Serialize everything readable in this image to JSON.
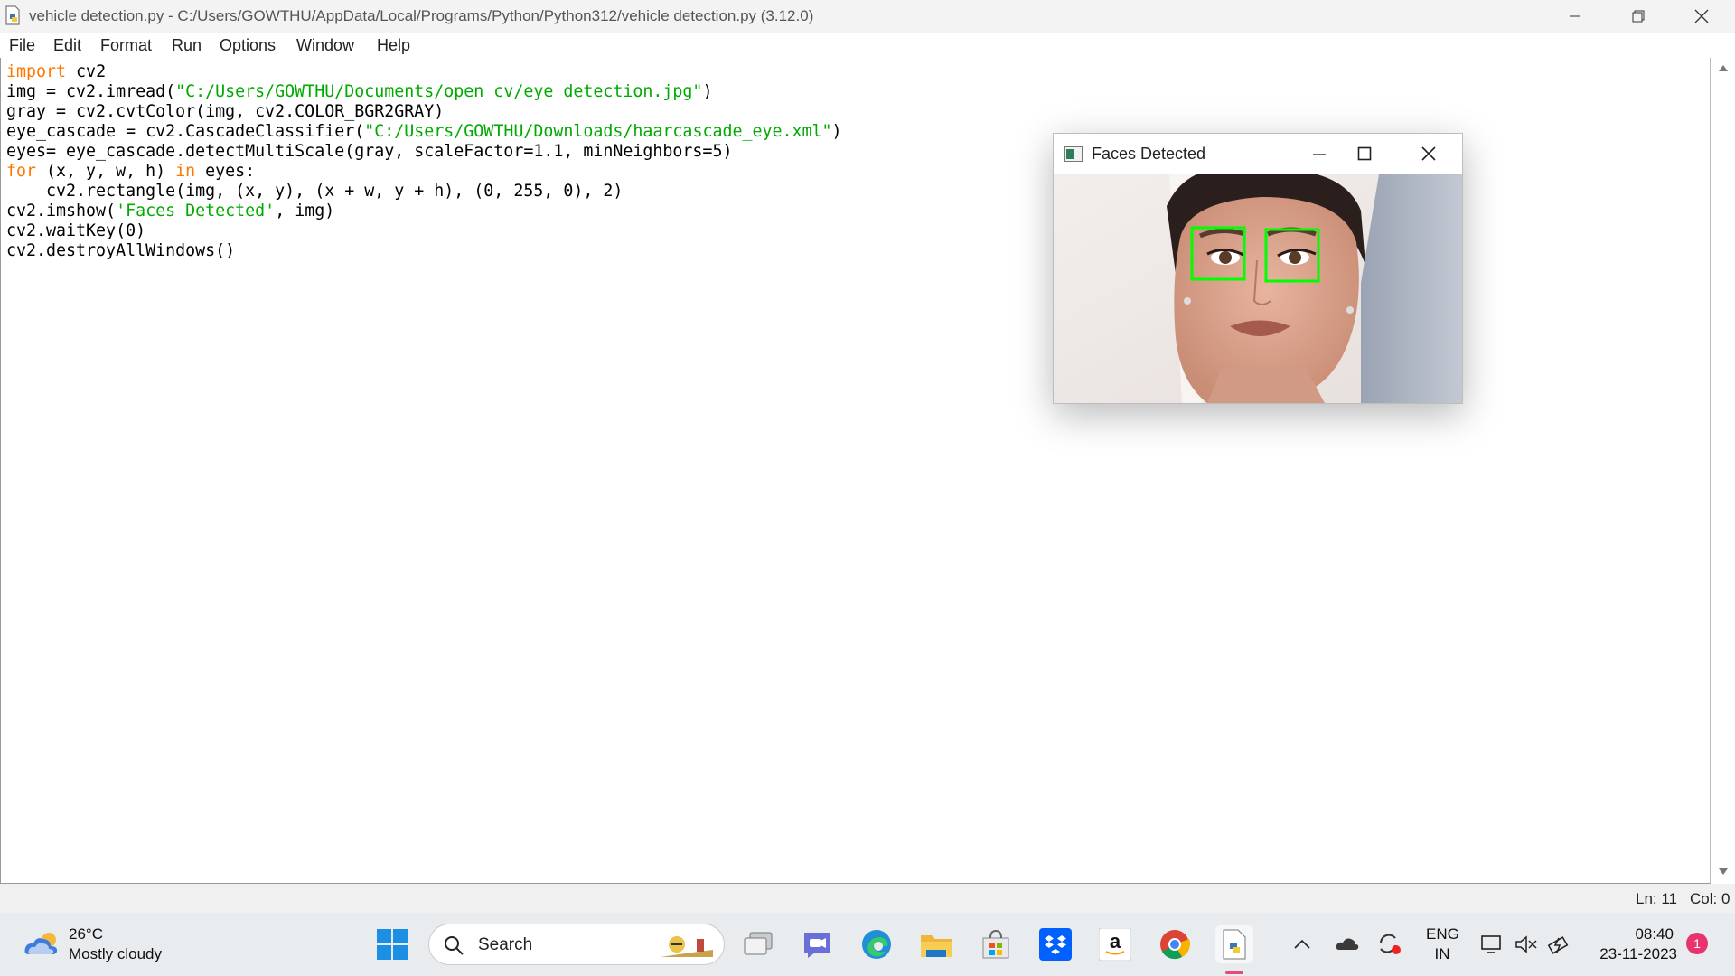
{
  "window": {
    "title": "vehicle detection.py - C:/Users/GOWTHU/AppData/Local/Programs/Python/Python312/vehicle detection.py (3.12.0)"
  },
  "menu": [
    "File",
    "Edit",
    "Format",
    "Run",
    "Options",
    "Window",
    "Help"
  ],
  "code": {
    "line1": {
      "kw": "import",
      "rest": " cv2"
    },
    "line2": {
      "a": "img = cv2.imread(",
      "s": "\"C:/Users/GOWTHU/Documents/open cv/eye detection.jpg\"",
      "b": ")"
    },
    "line3": "gray = cv2.cvtColor(img, cv2.COLOR_BGR2GRAY)",
    "line4": {
      "a": "eye_cascade = cv2.CascadeClassifier(",
      "s": "\"C:/Users/GOWTHU/Downloads/haarcascade_eye.xml\"",
      "b": ")"
    },
    "line5": "eyes= eye_cascade.detectMultiScale(gray, scaleFactor=1.1, minNeighbors=5)",
    "line6": {
      "kw1": "for",
      "a": " (x, y, w, h) ",
      "kw2": "in",
      "b": " eyes:"
    },
    "line7": "    cv2.rectangle(img, (x, y), (x + w, y + h), (0, 255, 0), 2)",
    "line8": {
      "a": "cv2.imshow(",
      "s": "'Faces Detected'",
      "b": ", img)"
    },
    "line9": "cv2.waitKey(0)",
    "line10": "cv2.destroyAllWindows()"
  },
  "status": {
    "line": "Ln: 11",
    "col": "Col: 0"
  },
  "cv_window": {
    "title": "Faces Detected"
  },
  "taskbar": {
    "weather_temp": "26°C",
    "weather_desc": "Mostly cloudy",
    "search_placeholder": "Search",
    "lang_top": "ENG",
    "lang_bottom": "IN",
    "time": "08:40",
    "date": "23-11-2023",
    "notification_count": "1"
  },
  "colors": {
    "keyword": "#ff7700",
    "string": "#00aa00",
    "detect_box": "#00ff00"
  }
}
